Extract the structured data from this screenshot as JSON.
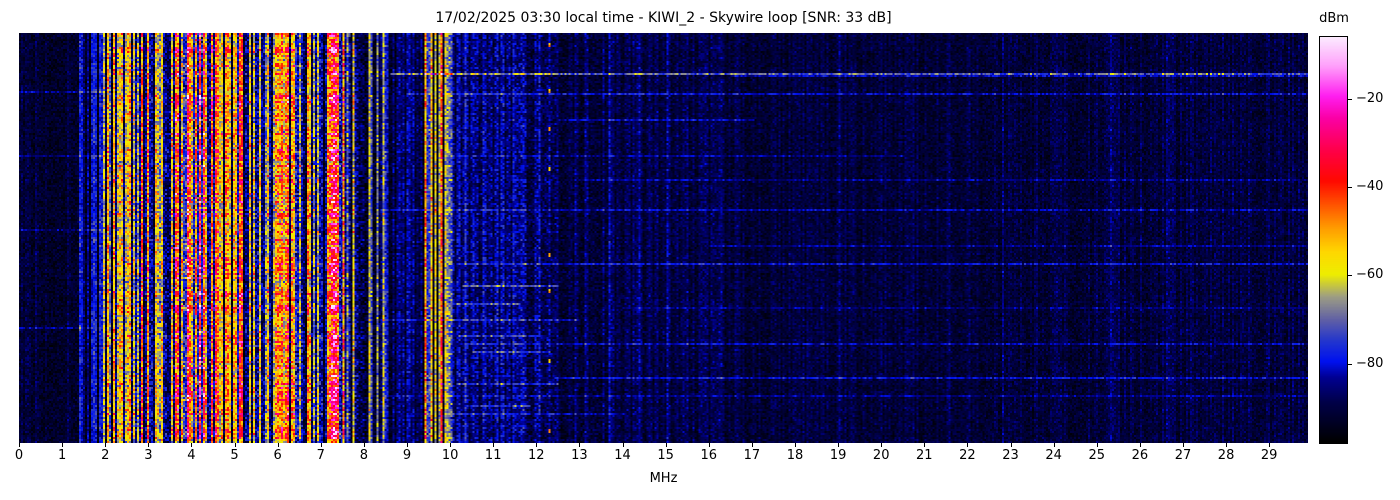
{
  "title": "17/02/2025 03:30 local time - KIWI_2 - Skywire loop [SNR: 33 dB]",
  "x_axis": {
    "label": "MHz",
    "tick_values": [
      0,
      1,
      2,
      3,
      4,
      5,
      6,
      7,
      8,
      9,
      10,
      11,
      12,
      13,
      14,
      15,
      16,
      17,
      18,
      19,
      20,
      21,
      22,
      23,
      24,
      25,
      26,
      27,
      28,
      29
    ],
    "tick_labels": [
      "0",
      "1",
      "2",
      "3",
      "4",
      "5",
      "6",
      "7",
      "8",
      "9",
      "10",
      "11",
      "12",
      "13",
      "14",
      "15",
      "16",
      "17",
      "18",
      "19",
      "20",
      "21",
      "22",
      "23",
      "24",
      "25",
      "26",
      "27",
      "28",
      "29"
    ]
  },
  "colorbar": {
    "label": "dBm",
    "min": -98,
    "max": -6,
    "ticks": [
      {
        "value": -20,
        "label": "−20"
      },
      {
        "value": -40,
        "label": "−40"
      },
      {
        "value": -60,
        "label": "−60"
      },
      {
        "value": -80,
        "label": "−80"
      }
    ]
  },
  "chart_data": {
    "type": "heatmap",
    "title": "17/02/2025 03:30 local time - KIWI_2 - Skywire loop [SNR: 33 dB]",
    "datetime_local": "17/02/2025 03:30",
    "station": "KIWI_2",
    "antenna": "Skywire loop",
    "snr_db": 33,
    "xlabel": "MHz",
    "x_range": [
      0,
      29.9
    ],
    "y_axis": "time (waterfall, no tick labels)",
    "value_unit": "dBm",
    "value_range": [
      -98,
      -6
    ],
    "legend_position": "right colorbar",
    "grid": false,
    "seed": 1337,
    "colormap_stops": [
      [
        0.0,
        "#000000"
      ],
      [
        0.1,
        "#00004a"
      ],
      [
        0.16,
        "#000092"
      ],
      [
        0.2,
        "#0012f0"
      ],
      [
        0.25,
        "#2336cf"
      ],
      [
        0.3,
        "#5e5ea8"
      ],
      [
        0.36,
        "#9e9e84"
      ],
      [
        0.415,
        "#eeee00"
      ],
      [
        0.47,
        "#ffd800"
      ],
      [
        0.53,
        "#ff9c00"
      ],
      [
        0.59,
        "#ff5000"
      ],
      [
        0.645,
        "#ff0a00"
      ],
      [
        0.72,
        "#ff0048"
      ],
      [
        0.8,
        "#fb00a5"
      ],
      [
        0.855,
        "#ff1ef0"
      ],
      [
        0.93,
        "#ffa1fb"
      ],
      [
        1.0,
        "#fcebff"
      ]
    ],
    "bands": [
      [
        0.0,
        1.38,
        0.065,
        0.055,
        0.02
      ],
      [
        1.38,
        1.95,
        0.085,
        0.06,
        0.09
      ],
      [
        1.95,
        2.25,
        0.17,
        0.1,
        0.2
      ],
      [
        2.25,
        2.95,
        0.25,
        0.12,
        0.2
      ],
      [
        2.95,
        3.4,
        0.23,
        0.12,
        0.2
      ],
      [
        3.4,
        4.45,
        0.3,
        0.13,
        0.22
      ],
      [
        4.45,
        5.45,
        0.25,
        0.12,
        0.2
      ],
      [
        5.45,
        5.95,
        0.21,
        0.12,
        0.18
      ],
      [
        5.95,
        6.55,
        0.28,
        0.13,
        0.21
      ],
      [
        6.55,
        7.18,
        0.23,
        0.12,
        0.2
      ],
      [
        7.18,
        7.48,
        0.34,
        0.14,
        0.24
      ],
      [
        7.48,
        8.05,
        0.23,
        0.12,
        0.2
      ],
      [
        8.05,
        8.55,
        0.15,
        0.1,
        0.14
      ],
      [
        8.55,
        9.35,
        0.09,
        0.07,
        0.05
      ],
      [
        9.35,
        10.05,
        0.16,
        0.1,
        0.16
      ],
      [
        10.05,
        12.45,
        0.115,
        0.085,
        0.04
      ],
      [
        12.45,
        13.6,
        0.085,
        0.065,
        0.03
      ],
      [
        13.6,
        16.4,
        0.08,
        0.06,
        0.025
      ],
      [
        16.4,
        21.0,
        0.072,
        0.055,
        0.02
      ],
      [
        21.0,
        29.95,
        0.075,
        0.055,
        0.02
      ]
    ],
    "carriers": [
      [
        1.43,
        0.03,
        0.22
      ],
      [
        1.62,
        0.02,
        0.2
      ],
      [
        1.8,
        0.02,
        0.2
      ],
      [
        1.97,
        0.02,
        0.33
      ],
      [
        2.06,
        0.02,
        0.4
      ],
      [
        2.31,
        0.02,
        0.38
      ],
      [
        2.5,
        0.03,
        0.42
      ],
      [
        2.66,
        0.04,
        0.41
      ],
      [
        2.83,
        0.02,
        0.36
      ],
      [
        3.2,
        0.03,
        0.44
      ],
      [
        3.33,
        0.02,
        0.42
      ],
      [
        3.7,
        0.03,
        0.55
      ],
      [
        3.8,
        0.02,
        0.6
      ],
      [
        3.95,
        0.04,
        0.62
      ],
      [
        4.1,
        0.02,
        0.55
      ],
      [
        4.28,
        0.03,
        0.63
      ],
      [
        4.65,
        0.02,
        0.33
      ],
      [
        4.8,
        0.03,
        0.42
      ],
      [
        5.0,
        0.03,
        0.45
      ],
      [
        5.1,
        0.02,
        0.42
      ],
      [
        5.35,
        0.02,
        0.4
      ],
      [
        6.0,
        0.03,
        0.52
      ],
      [
        6.1,
        0.03,
        0.58
      ],
      [
        6.19,
        0.02,
        0.55
      ],
      [
        6.31,
        0.02,
        0.49
      ],
      [
        6.85,
        0.02,
        0.32
      ],
      [
        7.22,
        0.02,
        0.63
      ],
      [
        7.3,
        0.05,
        0.72
      ],
      [
        7.42,
        0.02,
        0.54
      ],
      [
        7.6,
        0.02,
        0.44
      ],
      [
        7.75,
        0.02,
        0.42
      ],
      [
        8.12,
        0.02,
        0.36
      ],
      [
        8.33,
        0.02,
        0.3
      ],
      [
        9.42,
        0.02,
        0.58
      ],
      [
        9.58,
        0.02,
        0.45
      ],
      [
        9.68,
        0.02,
        0.42
      ],
      [
        9.79,
        0.02,
        0.55
      ],
      [
        9.9,
        0.02,
        0.4
      ],
      [
        9.97,
        0.03,
        0.33
      ],
      [
        10.35,
        0.02,
        0.18
      ],
      [
        11.18,
        0.02,
        0.17
      ],
      [
        12.0,
        0.02,
        0.16
      ],
      [
        13.7,
        0.02,
        0.17
      ]
    ],
    "h_lines": [
      [
        0.098,
        8.6,
        29.95,
        0.2
      ],
      [
        0.105,
        16.5,
        29.95,
        0.1
      ],
      [
        0.146,
        9.0,
        29.95,
        0.11
      ],
      [
        0.21,
        12.5,
        17.0,
        0.09
      ],
      [
        0.3,
        10.0,
        20.5,
        0.07
      ],
      [
        0.36,
        13.0,
        29.95,
        0.06
      ],
      [
        0.43,
        8.4,
        29.95,
        0.09
      ],
      [
        0.52,
        16.0,
        29.95,
        0.07
      ],
      [
        0.565,
        10.2,
        29.95,
        0.11
      ],
      [
        0.62,
        10.3,
        12.45,
        0.15
      ],
      [
        0.66,
        10.05,
        11.6,
        0.12
      ],
      [
        0.67,
        14.0,
        29.95,
        0.06
      ],
      [
        0.7,
        8.4,
        13.0,
        0.1
      ],
      [
        0.74,
        10.2,
        12.0,
        0.12
      ],
      [
        0.76,
        10.4,
        29.95,
        0.09
      ],
      [
        0.78,
        10.5,
        12.3,
        0.12
      ],
      [
        0.845,
        12.4,
        29.95,
        0.12
      ],
      [
        0.86,
        10.2,
        12.45,
        0.11
      ],
      [
        0.885,
        8.5,
        29.95,
        0.07
      ],
      [
        0.91,
        10.4,
        11.8,
        0.1
      ],
      [
        0.93,
        10.0,
        14.0,
        0.09
      ],
      [
        0.14,
        0.0,
        1.95,
        0.09
      ],
      [
        0.3,
        0.0,
        1.95,
        0.07
      ],
      [
        0.48,
        0.0,
        1.95,
        0.07
      ],
      [
        0.72,
        0.0,
        1.95,
        0.08
      ]
    ],
    "v_lines": [
      [
        13.7,
        0.05
      ],
      [
        14.35,
        0.04
      ],
      [
        15.0,
        0.045
      ],
      [
        15.95,
        0.035
      ],
      [
        16.8,
        0.035
      ],
      [
        17.6,
        0.03
      ],
      [
        18.3,
        0.03
      ],
      [
        19.0,
        0.035
      ],
      [
        20.4,
        0.03
      ],
      [
        21.5,
        0.04
      ],
      [
        22.8,
        0.03
      ],
      [
        24.0,
        0.03
      ],
      [
        25.3,
        0.035
      ],
      [
        26.6,
        0.03
      ],
      [
        27.9,
        0.03
      ],
      [
        10.35,
        0.05
      ],
      [
        10.9,
        0.04
      ],
      [
        11.45,
        0.05
      ],
      [
        12.0,
        0.04
      ]
    ],
    "beacon_dots": {
      "freq": 12.28,
      "value": 0.5,
      "y_fracs": [
        0.025,
        0.135,
        0.232,
        0.327,
        0.54,
        0.625,
        0.8,
        0.97
      ]
    }
  }
}
